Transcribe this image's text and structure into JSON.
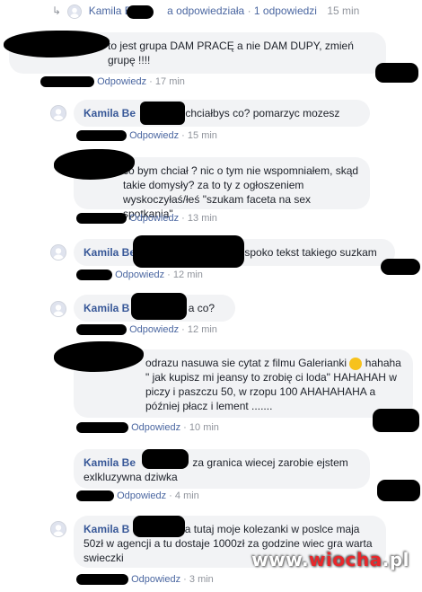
{
  "top_reply": {
    "arrow": "reply-arrow",
    "author": "Kamila Bed",
    "author_tail": "a",
    "verb": "odpowiedziała",
    "dot": "·",
    "count": "1 odpowiedzi",
    "time": "15 min"
  },
  "comments": [
    {
      "author": "",
      "text": "to jest grupa DAM PRACĘ a nie DAM DUPY, zmień grupę !!!!",
      "reply": "Odpowiedz",
      "time": "17 min"
    },
    {
      "author": "Kamila Be",
      "text": "chciałbys co? pomarzyc mozesz",
      "reply": "Odpowiedz",
      "time": "15 min"
    },
    {
      "author": "",
      "text": "co bym chciał ? nic o tym nie wspomniałem, skąd takie domysły? za to ty z ogłoszeniem wyskoczyłaś/łeś \"szukam faceta na sex spotkania\"",
      "reply": "Odpowiedz",
      "time": "13 min"
    },
    {
      "author": "Kamila Be",
      "text": "spoko tekst takiego suzkam",
      "reply": "Odpowiedz",
      "time": "12 min"
    },
    {
      "author": "Kamila B",
      "text": "a co?",
      "reply": "Odpowiedz",
      "time": "12 min"
    },
    {
      "author": "",
      "text_line1": "odrazu nasuwa sie cytat z filmu Galerianki",
      "emoji": "😀",
      "text_rest": "hahaha \" jak kupisz mi jeansy to zrobię ci loda\" HAHAHAH w piczy i paszczu 50, w rzopu 100 AHAHAHAHA a później płacz i lement .......",
      "reply": "Odpowiedz",
      "time": "10 min"
    },
    {
      "author": "Kamila Be",
      "text": "za granica wiecej zarobie ejstem exlkluzywna dziwka",
      "reply": "Odpowiedz",
      "time": "4 min"
    },
    {
      "author": "Kamila B",
      "text": "a tutaj moje kolezanki w poslce maja 50zł w agencji a tu dostaje 1000zł za godzine wiec gra warta swieczki",
      "reply": "Odpowiedz",
      "time": "3 min"
    }
  ],
  "separator": "·",
  "watermark": {
    "prefix": "www.",
    "brand": "wiocha",
    "suffix": ".pl"
  }
}
